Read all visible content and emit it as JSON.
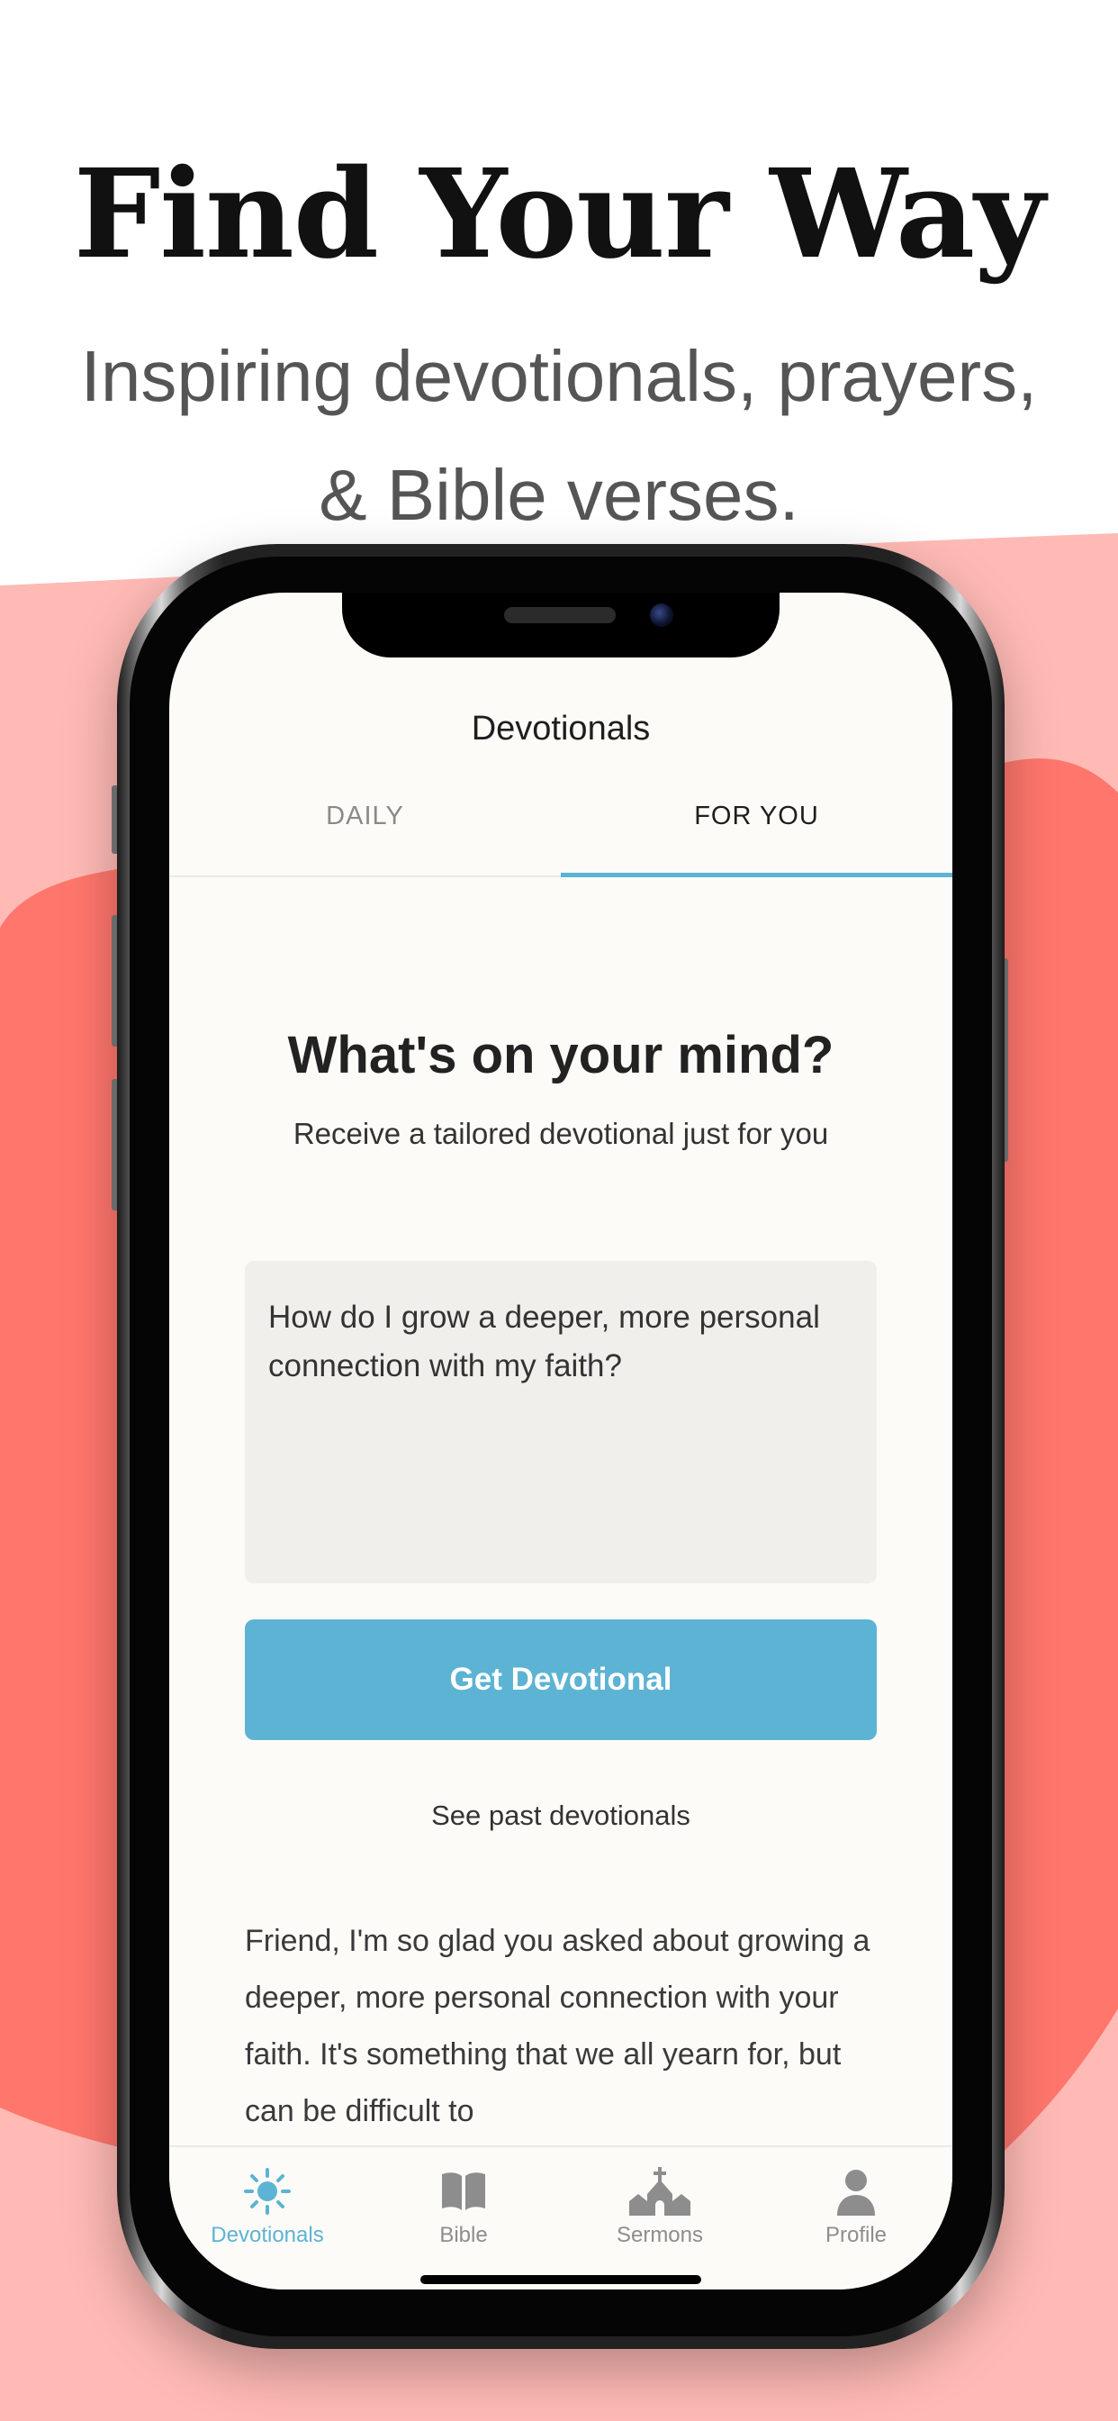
{
  "marketing": {
    "headline": "Find Your Way",
    "subhead": "Inspiring devotionals, prayers, & Bible verses."
  },
  "colors": {
    "accent": "#5db3d3",
    "background_blob_light": "#ffbab5",
    "background_blob_dark": "#ff766c"
  },
  "screen": {
    "nav_title": "Devotionals",
    "tabs": [
      {
        "label": "DAILY",
        "active": false
      },
      {
        "label": "FOR YOU",
        "active": true
      }
    ],
    "heading": "What's on your mind?",
    "subheading": "Receive a tailored devotional just for you",
    "prompt_value": "How do I grow a deeper, more personal connection with my faith?",
    "cta_label": "Get Devotional",
    "past_link": "See past devotionals",
    "response_text": "Friend, I'm so glad you asked about growing a deeper, more personal connection with your faith. It's something that we all yearn for, but can be difficult to"
  },
  "tabbar": {
    "items": [
      {
        "label": "Devotionals",
        "icon": "sun-icon",
        "active": true
      },
      {
        "label": "Bible",
        "icon": "book-icon",
        "active": false
      },
      {
        "label": "Sermons",
        "icon": "church-icon",
        "active": false
      },
      {
        "label": "Profile",
        "icon": "person-icon",
        "active": false
      }
    ]
  }
}
